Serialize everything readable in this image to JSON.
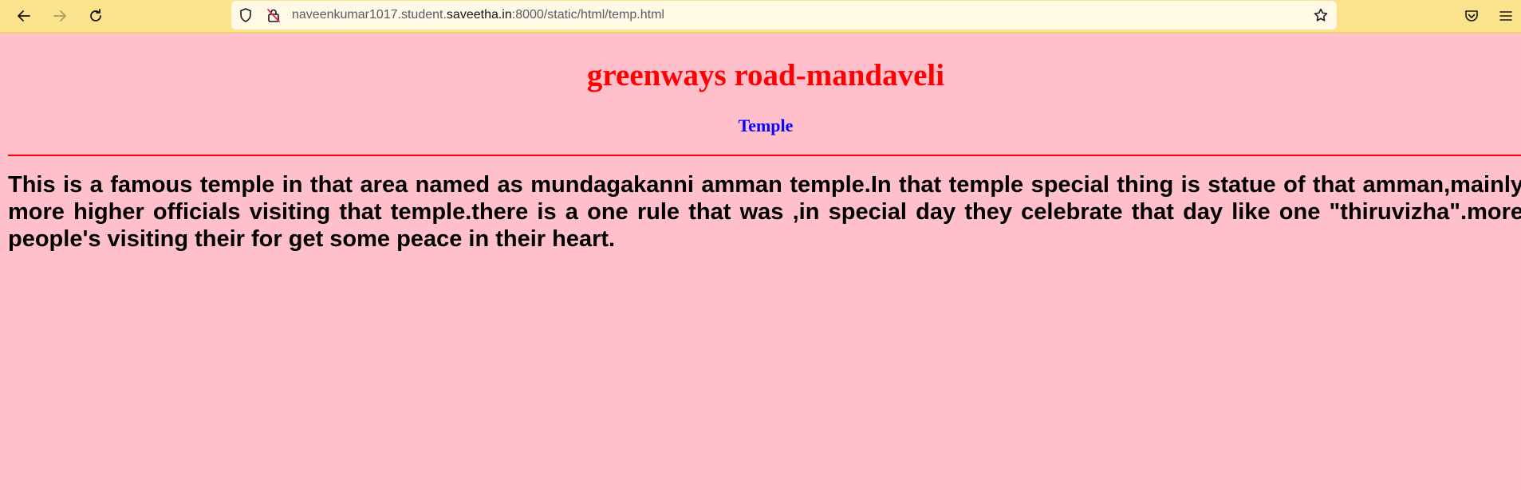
{
  "browser": {
    "url_prefix": "naveenkumar1017.student.",
    "url_domain": "saveetha.in",
    "url_suffix": ":8000/static/html/temp.html",
    "icons": [
      "back-icon",
      "forward-icon",
      "reload-icon",
      "shield-icon",
      "insecure-lock-icon",
      "bookmark-star-icon",
      "pocket-icon",
      "menu-icon"
    ]
  },
  "page": {
    "title": "greenways road-mandaveli",
    "subtitle": "Temple",
    "paragraph": "This is a famous temple in that area named as mundagakanni amman temple.In that temple special thing is statue of that amman,mainly more higher officials visiting that temple.there is a one rule that was ,in special day they celebrate that day like one \"thiruvizha\".more people's visiting their for get some peace in their heart."
  },
  "colors": {
    "toolbar_bg": "#fbe38e",
    "page_bg": "#ffc0cb",
    "title": "#ff0000",
    "subtitle": "#0000ff",
    "rule": "#ff0000"
  }
}
